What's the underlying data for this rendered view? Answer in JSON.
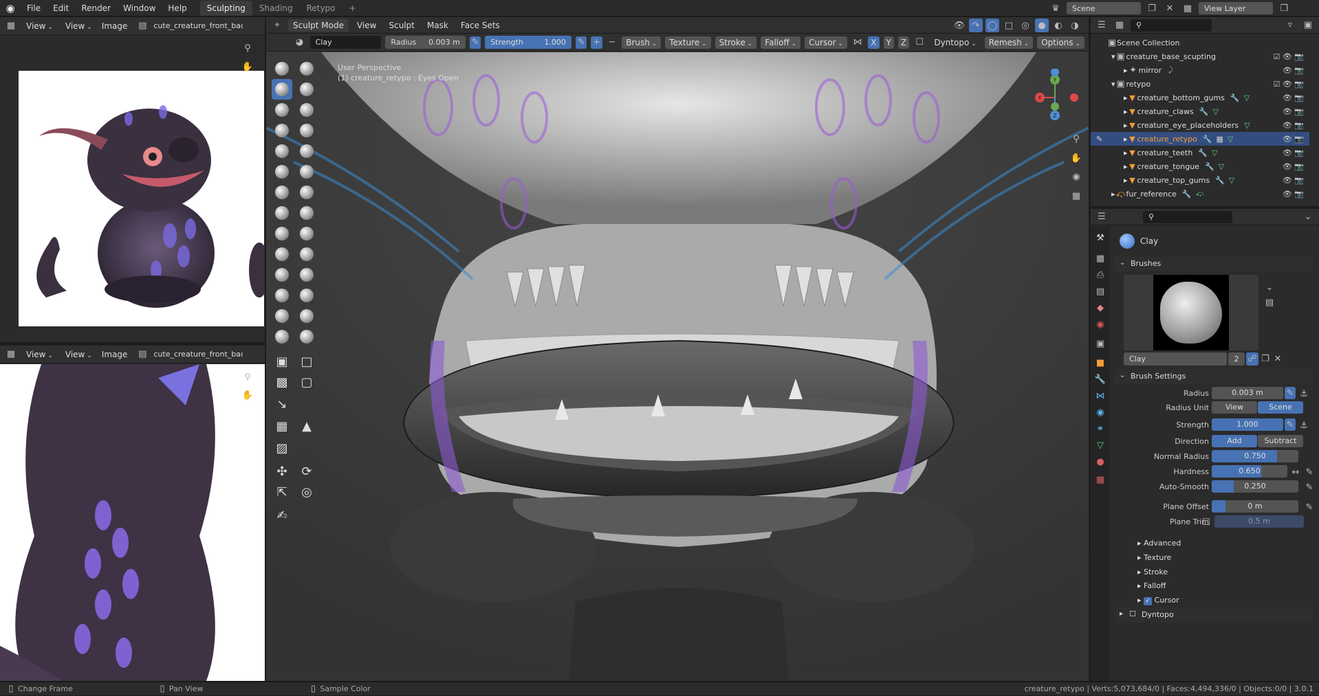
{
  "topbar": {
    "menus": [
      "File",
      "Edit",
      "Render",
      "Window",
      "Help"
    ],
    "workspaces": [
      "Sculpting",
      "Shading",
      "Retypo"
    ],
    "active_workspace": "Sculpting",
    "add_symbol": "+",
    "scene_label": "Scene",
    "view_layer_label": "View Layer"
  },
  "image_editor_top": {
    "view_menu": "View",
    "view2": "View",
    "image": "Image",
    "image_name": "cute_creature_front_back."
  },
  "image_editor_bottom": {
    "view_menu": "View",
    "view2": "View",
    "image": "Image",
    "image_name": "cute_creature_front_back."
  },
  "viewport": {
    "mode": "Sculpt Mode",
    "menus": [
      "View",
      "Sculpt",
      "Mask",
      "Face Sets"
    ],
    "brush_name": "Clay",
    "radius_label": "Radius",
    "radius_value": "0.003 m",
    "strength_label": "Strength",
    "strength_value": "1.000",
    "plus": "+",
    "minus": "−",
    "dropdowns": [
      "Brush",
      "Texture",
      "Stroke",
      "Falloff",
      "Cursor"
    ],
    "axes": [
      "X",
      "Y",
      "Z"
    ],
    "dyntopo": "Dyntopo",
    "remesh": "Remesh",
    "options": "Options",
    "perspective": "User Perspective",
    "object_info": "(1) creature_retypo : Eyes Open",
    "gizmo_axes": {
      "x": "X",
      "y": "Y",
      "z": "Z"
    }
  },
  "outliner": {
    "root": "Scene Collection",
    "items": [
      {
        "label": "creature_base_scupting",
        "type": "collection"
      },
      {
        "label": "mirror",
        "type": "object"
      },
      {
        "label": "retypo",
        "type": "collection"
      },
      {
        "label": "creature_bottom_gums",
        "type": "mesh"
      },
      {
        "label": "creature_claws",
        "type": "mesh"
      },
      {
        "label": "creature_eye_placeholders",
        "type": "mesh"
      },
      {
        "label": "creature_retypo",
        "type": "mesh",
        "selected": true
      },
      {
        "label": "creature_teeth",
        "type": "mesh"
      },
      {
        "label": "creature_tongue",
        "type": "mesh"
      },
      {
        "label": "creature_top_gums",
        "type": "mesh"
      },
      {
        "label": "fur_reference",
        "type": "object"
      }
    ]
  },
  "properties": {
    "brush_title": "Clay",
    "brushes_panel": "Brushes",
    "brush_field": "Clay",
    "brush_users": "2",
    "brush_settings": "Brush Settings",
    "rows": [
      {
        "label": "Radius",
        "value": "0.003 m"
      },
      {
        "label": "Radius Unit",
        "value": "View",
        "value2": "Scene"
      },
      {
        "label": "Strength",
        "value": "1.000"
      },
      {
        "label": "Direction",
        "value": "Add",
        "value2": "Subtract"
      },
      {
        "label": "Normal Radius",
        "value": "0.750",
        "fill": 0.75
      },
      {
        "label": "Hardness",
        "value": "0.650",
        "fill": 0.65
      },
      {
        "label": "Auto-Smooth",
        "value": "0.250",
        "fill": 0.25
      },
      {
        "label": "Plane Offset",
        "value": "0 m"
      },
      {
        "label": "Plane Trim",
        "value": "0.5 m"
      }
    ],
    "subpanels": [
      "Advanced",
      "Texture",
      "Stroke",
      "Falloff",
      "Cursor"
    ],
    "dyntopo": "Dyntopo"
  },
  "status": {
    "items": [
      "Change Frame",
      "Pan View",
      "Sample Color"
    ],
    "stats": "creature_retypo | Verts:5,073,684/0 | Faces:4,494,336/0 | Objects:0/0 | 3.0.1"
  },
  "colors": {
    "accent": "#4772b3",
    "header": "#303030",
    "panel": "#2b2b2b",
    "orange": "#f59e38"
  }
}
